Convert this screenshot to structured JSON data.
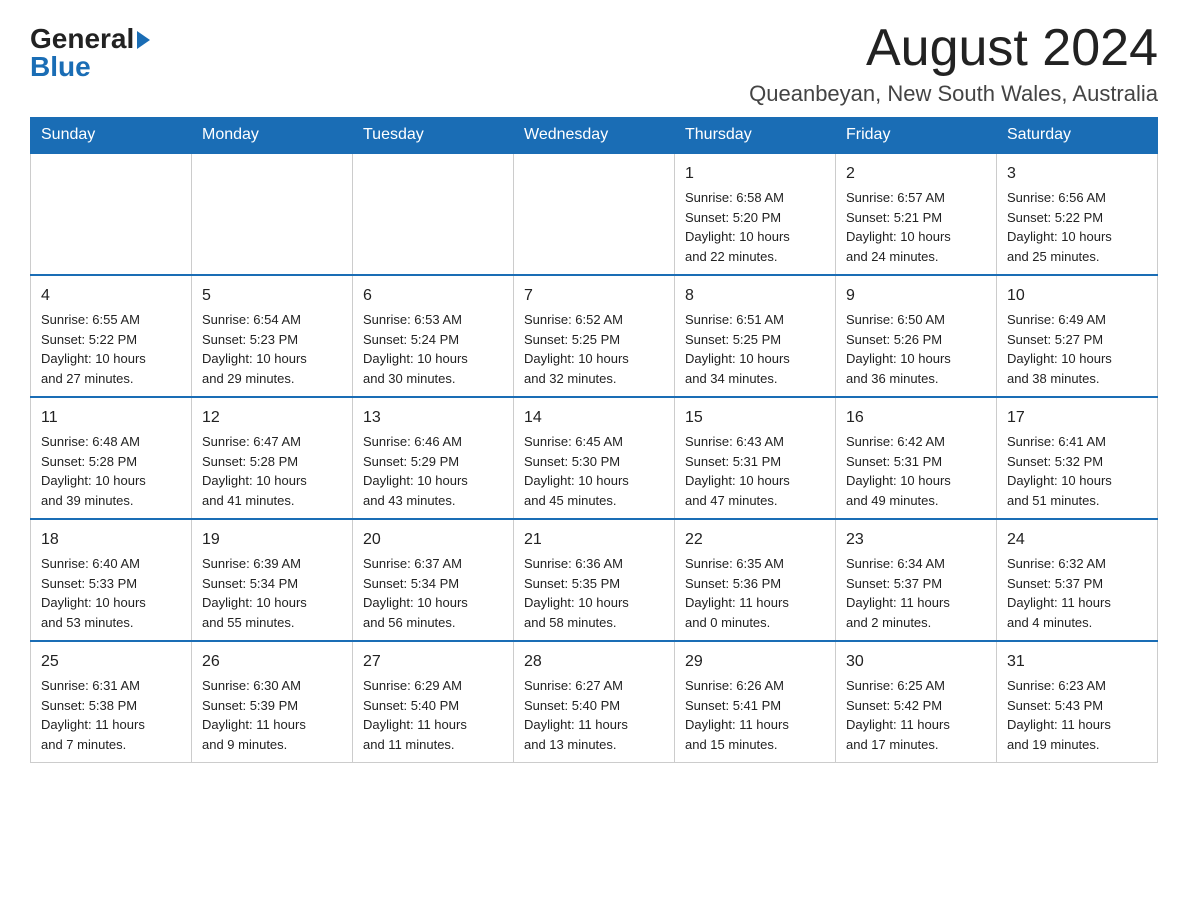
{
  "header": {
    "logo_general": "General",
    "logo_arrow": "▶",
    "logo_blue": "Blue",
    "month_title": "August 2024",
    "location": "Queanbeyan, New South Wales, Australia"
  },
  "weekdays": [
    "Sunday",
    "Monday",
    "Tuesday",
    "Wednesday",
    "Thursday",
    "Friday",
    "Saturday"
  ],
  "weeks": [
    [
      {
        "day": "",
        "info": ""
      },
      {
        "day": "",
        "info": ""
      },
      {
        "day": "",
        "info": ""
      },
      {
        "day": "",
        "info": ""
      },
      {
        "day": "1",
        "info": "Sunrise: 6:58 AM\nSunset: 5:20 PM\nDaylight: 10 hours\nand 22 minutes."
      },
      {
        "day": "2",
        "info": "Sunrise: 6:57 AM\nSunset: 5:21 PM\nDaylight: 10 hours\nand 24 minutes."
      },
      {
        "day": "3",
        "info": "Sunrise: 6:56 AM\nSunset: 5:22 PM\nDaylight: 10 hours\nand 25 minutes."
      }
    ],
    [
      {
        "day": "4",
        "info": "Sunrise: 6:55 AM\nSunset: 5:22 PM\nDaylight: 10 hours\nand 27 minutes."
      },
      {
        "day": "5",
        "info": "Sunrise: 6:54 AM\nSunset: 5:23 PM\nDaylight: 10 hours\nand 29 minutes."
      },
      {
        "day": "6",
        "info": "Sunrise: 6:53 AM\nSunset: 5:24 PM\nDaylight: 10 hours\nand 30 minutes."
      },
      {
        "day": "7",
        "info": "Sunrise: 6:52 AM\nSunset: 5:25 PM\nDaylight: 10 hours\nand 32 minutes."
      },
      {
        "day": "8",
        "info": "Sunrise: 6:51 AM\nSunset: 5:25 PM\nDaylight: 10 hours\nand 34 minutes."
      },
      {
        "day": "9",
        "info": "Sunrise: 6:50 AM\nSunset: 5:26 PM\nDaylight: 10 hours\nand 36 minutes."
      },
      {
        "day": "10",
        "info": "Sunrise: 6:49 AM\nSunset: 5:27 PM\nDaylight: 10 hours\nand 38 minutes."
      }
    ],
    [
      {
        "day": "11",
        "info": "Sunrise: 6:48 AM\nSunset: 5:28 PM\nDaylight: 10 hours\nand 39 minutes."
      },
      {
        "day": "12",
        "info": "Sunrise: 6:47 AM\nSunset: 5:28 PM\nDaylight: 10 hours\nand 41 minutes."
      },
      {
        "day": "13",
        "info": "Sunrise: 6:46 AM\nSunset: 5:29 PM\nDaylight: 10 hours\nand 43 minutes."
      },
      {
        "day": "14",
        "info": "Sunrise: 6:45 AM\nSunset: 5:30 PM\nDaylight: 10 hours\nand 45 minutes."
      },
      {
        "day": "15",
        "info": "Sunrise: 6:43 AM\nSunset: 5:31 PM\nDaylight: 10 hours\nand 47 minutes."
      },
      {
        "day": "16",
        "info": "Sunrise: 6:42 AM\nSunset: 5:31 PM\nDaylight: 10 hours\nand 49 minutes."
      },
      {
        "day": "17",
        "info": "Sunrise: 6:41 AM\nSunset: 5:32 PM\nDaylight: 10 hours\nand 51 minutes."
      }
    ],
    [
      {
        "day": "18",
        "info": "Sunrise: 6:40 AM\nSunset: 5:33 PM\nDaylight: 10 hours\nand 53 minutes."
      },
      {
        "day": "19",
        "info": "Sunrise: 6:39 AM\nSunset: 5:34 PM\nDaylight: 10 hours\nand 55 minutes."
      },
      {
        "day": "20",
        "info": "Sunrise: 6:37 AM\nSunset: 5:34 PM\nDaylight: 10 hours\nand 56 minutes."
      },
      {
        "day": "21",
        "info": "Sunrise: 6:36 AM\nSunset: 5:35 PM\nDaylight: 10 hours\nand 58 minutes."
      },
      {
        "day": "22",
        "info": "Sunrise: 6:35 AM\nSunset: 5:36 PM\nDaylight: 11 hours\nand 0 minutes."
      },
      {
        "day": "23",
        "info": "Sunrise: 6:34 AM\nSunset: 5:37 PM\nDaylight: 11 hours\nand 2 minutes."
      },
      {
        "day": "24",
        "info": "Sunrise: 6:32 AM\nSunset: 5:37 PM\nDaylight: 11 hours\nand 4 minutes."
      }
    ],
    [
      {
        "day": "25",
        "info": "Sunrise: 6:31 AM\nSunset: 5:38 PM\nDaylight: 11 hours\nand 7 minutes."
      },
      {
        "day": "26",
        "info": "Sunrise: 6:30 AM\nSunset: 5:39 PM\nDaylight: 11 hours\nand 9 minutes."
      },
      {
        "day": "27",
        "info": "Sunrise: 6:29 AM\nSunset: 5:40 PM\nDaylight: 11 hours\nand 11 minutes."
      },
      {
        "day": "28",
        "info": "Sunrise: 6:27 AM\nSunset: 5:40 PM\nDaylight: 11 hours\nand 13 minutes."
      },
      {
        "day": "29",
        "info": "Sunrise: 6:26 AM\nSunset: 5:41 PM\nDaylight: 11 hours\nand 15 minutes."
      },
      {
        "day": "30",
        "info": "Sunrise: 6:25 AM\nSunset: 5:42 PM\nDaylight: 11 hours\nand 17 minutes."
      },
      {
        "day": "31",
        "info": "Sunrise: 6:23 AM\nSunset: 5:43 PM\nDaylight: 11 hours\nand 19 minutes."
      }
    ]
  ]
}
